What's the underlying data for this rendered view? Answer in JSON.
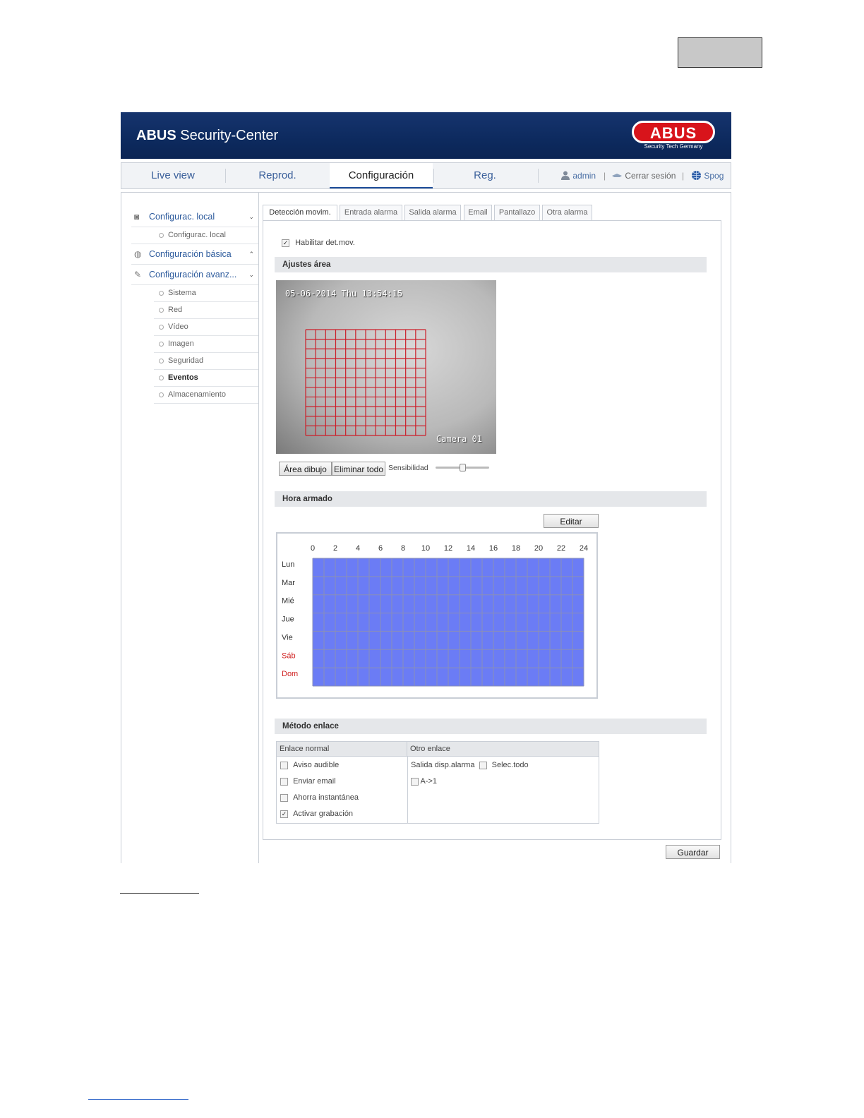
{
  "app_title_bold": "ABUS",
  "app_title_rest": " Security-Center",
  "logo": {
    "text": "ABUS",
    "subtitle": "Security Tech Germany"
  },
  "nav": {
    "items": [
      "Live view",
      "Reprod.",
      "Configuración",
      "Reg."
    ],
    "active": "Configuración",
    "user": "admin",
    "logout": "Cerrar sesión",
    "language": "Spog"
  },
  "sidebar": {
    "local": {
      "label": "Configurac. local",
      "sub": "Configurac. local"
    },
    "basic": {
      "label": "Configuración básica"
    },
    "advanced": {
      "label": "Configuración avanz...",
      "subs": [
        "Sistema",
        "Red",
        "Vídeo",
        "Imagen",
        "Seguridad",
        "Eventos",
        "Almacenamiento"
      ],
      "active": "Eventos"
    }
  },
  "tabs": [
    "Detección movim.",
    "Entrada alarma",
    "Salida alarma",
    "Email",
    "Pantallazo",
    "Otra alarma"
  ],
  "active_tab": "Detección movim.",
  "enable": {
    "label": "Habilitar det.mov.",
    "checked": true
  },
  "area": {
    "section": "Ajustes área",
    "osd_time": "05-06-2014 Thu 13:54:15",
    "osd_camera": "Camera 01",
    "draw_button": "Área dibujo",
    "clear_button": "Eliminar todo",
    "sensitivity_label": "Sensibilidad",
    "sensitivity_level": 0.5
  },
  "schedule": {
    "section": "Hora armado",
    "edit_button": "Editar",
    "hours": [
      "0",
      "2",
      "4",
      "6",
      "8",
      "10",
      "12",
      "14",
      "16",
      "18",
      "20",
      "22",
      "24"
    ],
    "days": [
      "Lun",
      "Mar",
      "Mié",
      "Jue",
      "Vie",
      "Sáb",
      "Dom"
    ],
    "weekend_color": "#d02020",
    "armed_color": "#6b7cf5"
  },
  "linkage": {
    "section": "Método enlace",
    "normal_header": "Enlace normal",
    "other_header": "Otro enlace",
    "normal": [
      {
        "label": "Aviso audible",
        "checked": false
      },
      {
        "label": "Enviar email",
        "checked": false
      },
      {
        "label": "Ahorra instantánea",
        "checked": false
      },
      {
        "label": "Activar grabación",
        "checked": true
      }
    ],
    "other_label": "Salida disp.alarma",
    "select_all": "Selec.todo",
    "outputs": [
      {
        "label": "A->1",
        "checked": false
      }
    ]
  },
  "save_button": "Guardar",
  "colors": {
    "banner": "#0d2a5e",
    "link": "#2c5a9c",
    "logo_red": "#d8141b",
    "grid_red": "#cc1f2a"
  }
}
